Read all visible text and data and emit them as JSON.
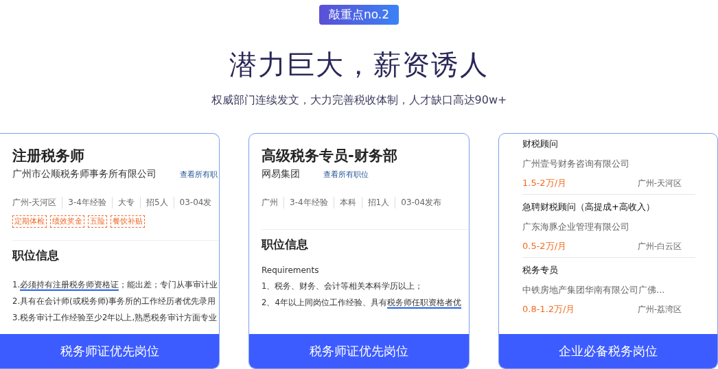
{
  "badge": "敲重点no.2",
  "headline": "潜力巨大，薪资诱人",
  "subtitle": "权威部门连续发文，大力完善税收体制，人才缺口高达90w+",
  "cards": [
    {
      "kind": "detail",
      "title": "注册税务师",
      "company": "广州市公顺税务师事务所有限公司",
      "link": "查看所有职",
      "meta": [
        "广州-天河区",
        "3-4年经验",
        "大专",
        "招5人",
        "03-04发"
      ],
      "tags": [
        "定期体检",
        "绩效奖金",
        "五险",
        "餐饮补贴"
      ],
      "section": "职位信息",
      "lines": [
        [
          {
            "text": "1.",
            "underlined": false
          },
          {
            "text": "必须持有注册税务师资格证",
            "underlined": true
          },
          {
            "text": "；能出差；专门从事审计业",
            "underlined": false
          }
        ],
        [
          {
            "text": "2.具有在会计师(或税务师)事务所的工作经历者优先录用",
            "underlined": false
          }
        ],
        [
          {
            "text": "3.税务审计工作经验至少2年以上,熟悉税务审计方面专业",
            "underlined": false
          }
        ]
      ],
      "button": "税务师证优先岗位"
    },
    {
      "kind": "detail",
      "title": "高级税务专员-财务部",
      "company": "网易集团",
      "link": "查看所有职位",
      "meta": [
        "广州",
        "3-4年经验",
        "本科",
        "招1人",
        "03-04发布"
      ],
      "section": "职位信息",
      "intro": "Requirements",
      "lines": [
        [
          {
            "text": "1、税务、财务、会计等相关本科学历以上；",
            "underlined": false
          }
        ],
        [
          {
            "text": "2、4年以上同岗位工作经验、具有",
            "underlined": false
          },
          {
            "text": "税务师任职资格者优",
            "underlined": true
          }
        ]
      ],
      "button": "税务师证优先岗位"
    },
    {
      "kind": "list",
      "jobs": [
        {
          "title": "财税顾问",
          "company": "广州壹号财务咨询有限公司",
          "salary": "1.5-2万/月",
          "location": "广州-天河区"
        },
        {
          "title": "急聘财税顾问（高提成+高收入）",
          "company": "广东海豚企业管理有限公司",
          "salary": "0.5-2万/月",
          "location": "广州-白云区"
        },
        {
          "title": "税务专员",
          "company": "中铁房地产集团华南有限公司广佛...",
          "salary": "0.8-1.2万/月",
          "location": "广州-荔湾区"
        }
      ],
      "button": "企业必备税务岗位"
    }
  ]
}
